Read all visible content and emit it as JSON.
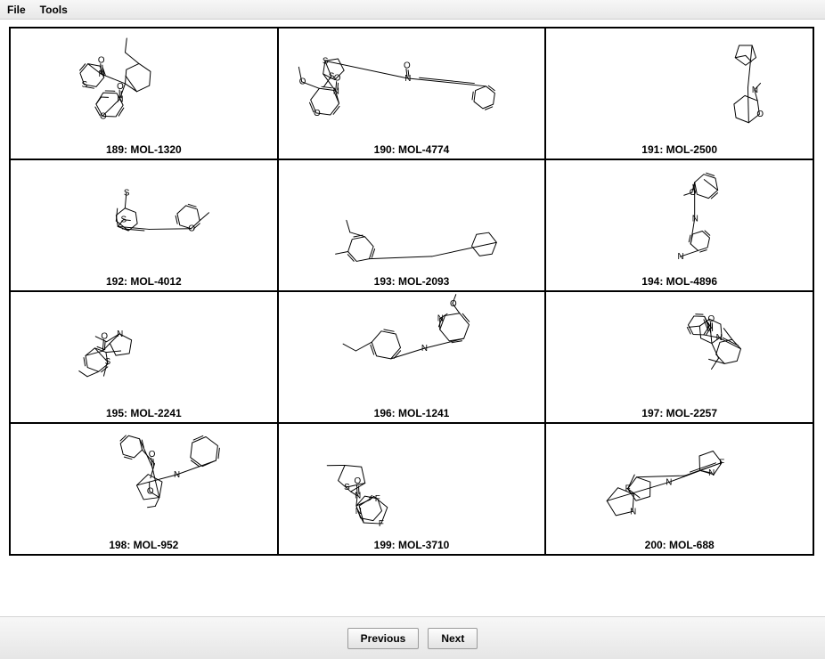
{
  "menubar": {
    "file": "File",
    "tools": "Tools"
  },
  "molecules": [
    {
      "index": 189,
      "id": "MOL-1320",
      "label": "189: MOL-1320"
    },
    {
      "index": 190,
      "id": "MOL-4774",
      "label": "190: MOL-4774"
    },
    {
      "index": 191,
      "id": "MOL-2500",
      "label": "191: MOL-2500"
    },
    {
      "index": 192,
      "id": "MOL-4012",
      "label": "192: MOL-4012"
    },
    {
      "index": 193,
      "id": "MOL-2093",
      "label": "193: MOL-2093"
    },
    {
      "index": 194,
      "id": "MOL-4896",
      "label": "194: MOL-4896"
    },
    {
      "index": 195,
      "id": "MOL-2241",
      "label": "195: MOL-2241"
    },
    {
      "index": 196,
      "id": "MOL-1241",
      "label": "196: MOL-1241"
    },
    {
      "index": 197,
      "id": "MOL-2257",
      "label": "197: MOL-2257"
    },
    {
      "index": 198,
      "id": "MOL-952",
      "label": "198: MOL-952"
    },
    {
      "index": 199,
      "id": "MOL-3710",
      "label": "199: MOL-3710"
    },
    {
      "index": 200,
      "id": "MOL-688",
      "label": "200: MOL-688"
    }
  ],
  "footer": {
    "previous": "Previous",
    "next": "Next"
  },
  "atom_labels": [
    "N",
    "O",
    "S",
    "F"
  ]
}
